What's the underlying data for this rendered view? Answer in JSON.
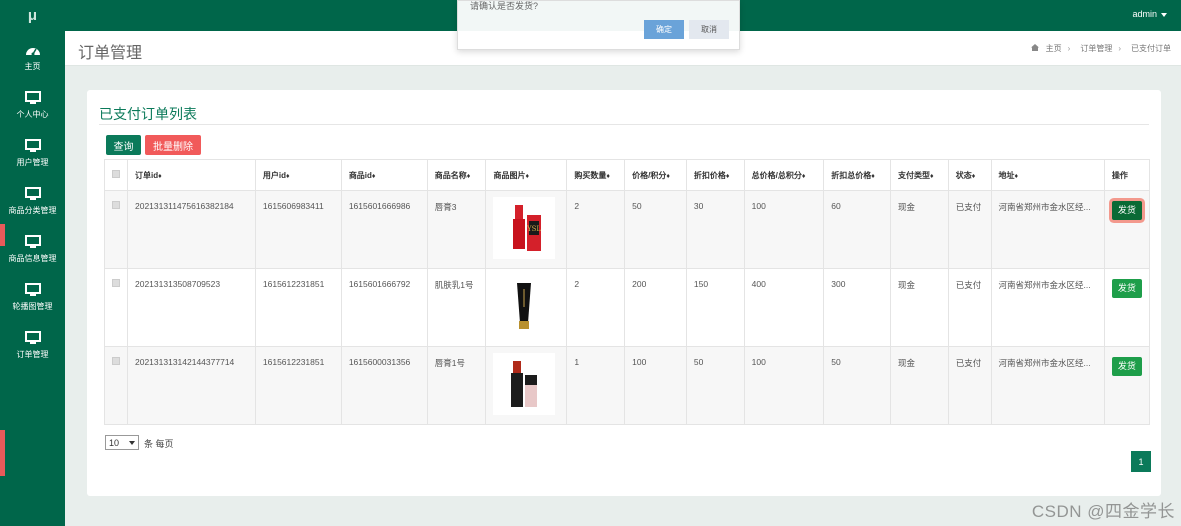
{
  "app": {
    "logo": "μ",
    "user": "admin"
  },
  "sidebar": {
    "items": [
      {
        "label": "主页",
        "icon": "dashboard-icon"
      },
      {
        "label": "个人中心",
        "icon": "monitor-icon"
      },
      {
        "label": "用户管理",
        "icon": "monitor-icon"
      },
      {
        "label": "商品分类管理",
        "icon": "monitor-icon"
      },
      {
        "label": "商品信息管理",
        "icon": "monitor-icon"
      },
      {
        "label": "轮播图管理",
        "icon": "monitor-icon"
      },
      {
        "label": "订单管理",
        "icon": "monitor-icon"
      }
    ]
  },
  "page": {
    "title": "订单管理",
    "breadcrumb": [
      "主页",
      "订单管理",
      "已支付订单"
    ]
  },
  "card": {
    "title": "已支付订单列表",
    "search_label": "查询",
    "batch_delete_label": "批量删除"
  },
  "table": {
    "columns": [
      "订单id",
      "用户id",
      "商品id",
      "商品名称",
      "商品图片",
      "购买数量",
      "价格/积分",
      "折扣价格",
      "总价格/总积分",
      "折扣总价格",
      "支付类型",
      "状态",
      "地址",
      "操作"
    ],
    "rows": [
      {
        "order_id": "202131311475616382184",
        "user_id": "1615606983411",
        "product_id": "1615601666986",
        "name": "唇膏3",
        "qty": "2",
        "price": "50",
        "discount": "30",
        "total": "100",
        "discount_total": "60",
        "pay_type": "现金",
        "status": "已支付",
        "address": "河南省郑州市金水区经...",
        "action": "发货",
        "image": "lipstick-red-icon"
      },
      {
        "order_id": "202131313508709523",
        "user_id": "1615612231851",
        "product_id": "1615601666792",
        "name": "肌肤乳1号",
        "qty": "2",
        "price": "200",
        "discount": "150",
        "total": "400",
        "discount_total": "300",
        "pay_type": "现金",
        "status": "已支付",
        "address": "河南省郑州市金水区经...",
        "action": "发货",
        "image": "foundation-tube-icon"
      },
      {
        "order_id": "202131313142144377714",
        "user_id": "1615612231851",
        "product_id": "1615600031356",
        "name": "唇膏1号",
        "qty": "1",
        "price": "100",
        "discount": "50",
        "total": "100",
        "discount_total": "50",
        "pay_type": "现金",
        "status": "已支付",
        "address": "河南省郑州市金水区经...",
        "action": "发货",
        "image": "lipstick-dark-icon"
      }
    ]
  },
  "pager": {
    "per_page": "10",
    "per_page_label": "条 每页",
    "current_page": "1"
  },
  "modal": {
    "message": "请确认是否发货?",
    "ok_label": "确定",
    "cancel_label": "取消"
  },
  "watermark": "CSDN @四金学长",
  "colors": {
    "primary": "#00664a",
    "accent": "#0b7a5a",
    "danger": "#f15a5a",
    "ship": "#1e9e4a"
  }
}
